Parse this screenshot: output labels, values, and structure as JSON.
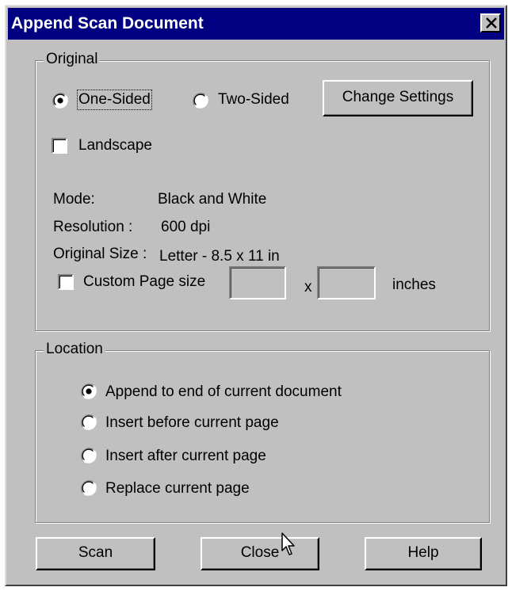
{
  "window": {
    "title": "Append Scan Document"
  },
  "original": {
    "legend": "Original",
    "one_sided": "One-Sided",
    "two_sided": "Two-Sided",
    "change_settings": "Change Settings",
    "landscape": "Landscape",
    "mode_label": "Mode:",
    "mode_value": "Black and White",
    "resolution_label": "Resolution :",
    "resolution_value": "600 dpi",
    "size_label": "Original Size :",
    "size_value": "Letter - 8.5 x 11 in",
    "custom_page_size": "Custom Page size",
    "custom_width": "",
    "custom_height": "",
    "x_label": "x",
    "units": "inches",
    "selected_side": "One-Sided",
    "landscape_checked": false,
    "custom_checked": false
  },
  "location": {
    "legend": "Location",
    "options": [
      "Append to end of current document",
      "Insert before current page",
      "Insert after current page",
      "Replace current page"
    ],
    "selected": "Append to end of current document"
  },
  "buttons": {
    "scan": "Scan",
    "close": "Close",
    "help": "Help"
  },
  "colors": {
    "title_bar": "#000080",
    "face": "#c0c0c0"
  }
}
